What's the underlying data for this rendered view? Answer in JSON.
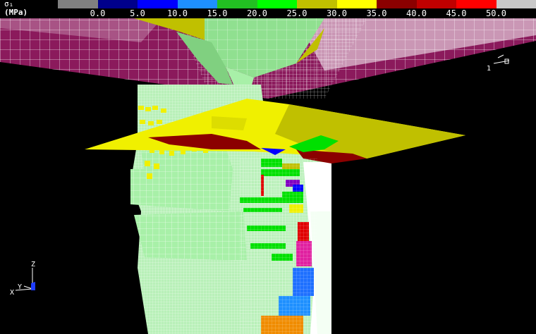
{
  "legend": {
    "symbol": "σ₁",
    "unit": "(MPa)",
    "ticks": [
      "0.0",
      "5.0",
      "10.0",
      "15.0",
      "20.0",
      "25.0",
      "30.0",
      "35.0",
      "40.0",
      "45.0",
      "50.0"
    ],
    "colors": [
      "#808080",
      "#00008b",
      "#0000ff",
      "#1e90ff",
      "#22c022",
      "#00ff00",
      "#c0c000",
      "#ffff00",
      "#8b0000",
      "#c00000",
      "#ff0000",
      "#c8c8c8"
    ]
  },
  "scene": {
    "colors": {
      "ground": "#8b1a5c",
      "mesh": "#a8f0a8",
      "yellow": "#f0f000",
      "olive": "#c0c000",
      "darkred": "#8b0000",
      "green": "#00e000",
      "blue": "#1e70ff",
      "orange": "#f08c00",
      "magenta": "#e020a0",
      "red": "#e00000",
      "purple": "#8000c0"
    }
  },
  "axes_triad": {
    "z": "Z",
    "x": "X",
    "y": "Y"
  },
  "node_label": "1"
}
